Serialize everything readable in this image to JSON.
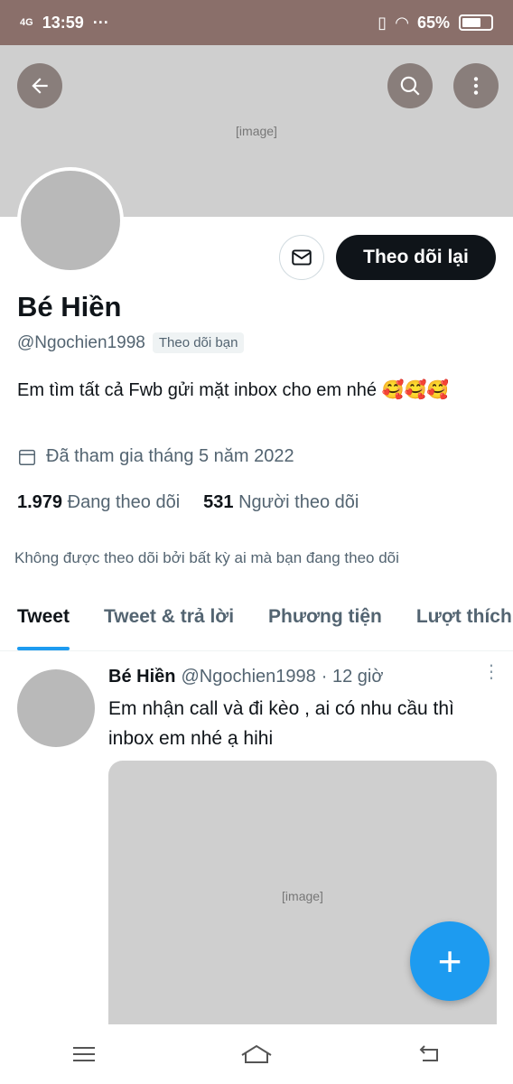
{
  "status": {
    "time": "13:59",
    "network": "4G",
    "dots": "···",
    "battery": "65%",
    "battery_level": 0.65
  },
  "banner": {
    "placeholder": "[image]"
  },
  "profile": {
    "name": "Bé Hiền",
    "handle": "@Ngochien1998",
    "follows_you": "Theo dõi bạn",
    "follow_button": "Theo dõi lại",
    "bio": "Em tìm tất cả Fwb  gửi mặt inbox cho em nhé 🥰🥰🥰",
    "joined": "Đã tham gia tháng 5 năm 2022",
    "following_count": "1.979",
    "following_label": "Đang theo dõi",
    "followers_count": "531",
    "followers_label": "Người theo dõi",
    "not_followed": "Không được theo dõi bởi bất kỳ ai mà bạn đang theo dõi"
  },
  "tabs": [
    "Tweet",
    "Tweet & trả lời",
    "Phương tiện",
    "Lượt thích"
  ],
  "tweet": {
    "name": "Bé Hiền",
    "handle": "@Ngochien1998",
    "time": "· 12 giờ",
    "text": "Em nhận call và đi kèo , ai có nhu cầu thì inbox em nhé ạ hihi",
    "media_placeholder": "[image]"
  },
  "colors": {
    "status_bar": "#8a6f6a",
    "accent": "#1d9bf0",
    "follow_button": "#0f1419"
  }
}
